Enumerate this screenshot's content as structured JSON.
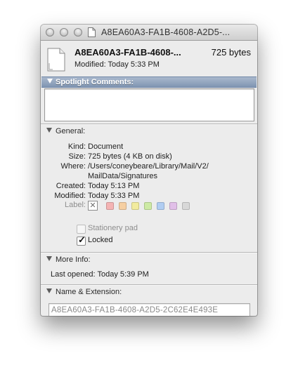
{
  "window": {
    "title": "A8EA60A3-FA1B-4608-A2D5-...",
    "buttons": [
      "close",
      "minimize",
      "zoom"
    ]
  },
  "header": {
    "icon": "document-icon",
    "file_name": "A8EA60A3-FA1B-4608-...",
    "file_size": "725 bytes",
    "modified": "Modified: Today 5:33 PM"
  },
  "spotlight": {
    "title": "Spotlight Comments:",
    "comments": ""
  },
  "general": {
    "title": "General:",
    "kind_label": "Kind:",
    "kind_value": "Document",
    "size_label": "Size:",
    "size_value": "725 bytes (4 KB on disk)",
    "where_label": "Where:",
    "where_line1": "/Users/coneybeare/Library/Mail/V2/",
    "where_line2": "MailData/Signatures",
    "created_label": "Created:",
    "created_value": "Today 5:13 PM",
    "modified_label": "Modified:",
    "modified_value": "Today 5:33 PM",
    "label_label": "Label:",
    "label_colors": [
      "#f4b3b3",
      "#f6cfa2",
      "#f2eb9e",
      "#cdeaa4",
      "#b0cdf2",
      "#e1bfe8",
      "#d8d8d8"
    ],
    "stationery_label": "Stationery pad",
    "stationery_checked": false,
    "locked_label": "Locked",
    "locked_checked": true
  },
  "more_info": {
    "title": "More Info:",
    "last_opened": "Last opened: Today 5:39 PM"
  },
  "name_ext": {
    "title": "Name & Extension:",
    "value": "A8EA60A3-FA1B-4608-A2D5-2C62E4E493E"
  }
}
